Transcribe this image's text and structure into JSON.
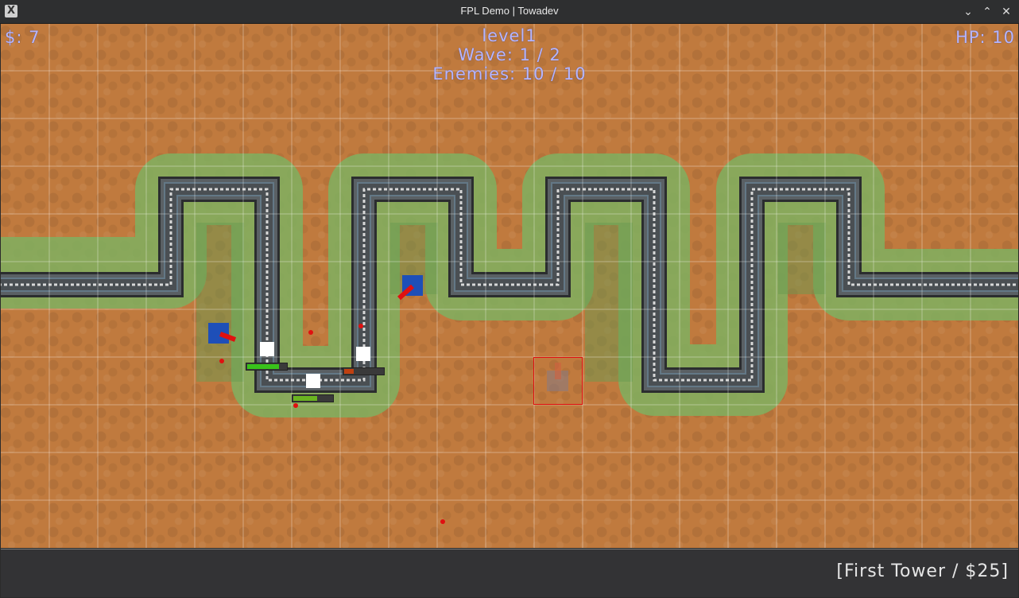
{
  "window": {
    "title": "FPL Demo | Towadev",
    "app_icon": "x-app-icon",
    "buttons": {
      "minimize": "⌄",
      "maximize": "⌃",
      "close": "✕"
    }
  },
  "hud": {
    "money": "$: 7",
    "hp": "HP: 10",
    "level": "level1",
    "wave": "Wave: 1 / 2",
    "enemies": "Enemies: 10 / 10"
  },
  "bottom_panel": {
    "tower_selection": "[First Tower / $25]"
  },
  "colors": {
    "ground": "#c07a3e",
    "grass": "#7fb060",
    "road": "#505558",
    "hud_text": "#b6b6ff",
    "tower": "#1e4fb8",
    "enemy": "#ffffff",
    "bullet": "#e01010"
  }
}
